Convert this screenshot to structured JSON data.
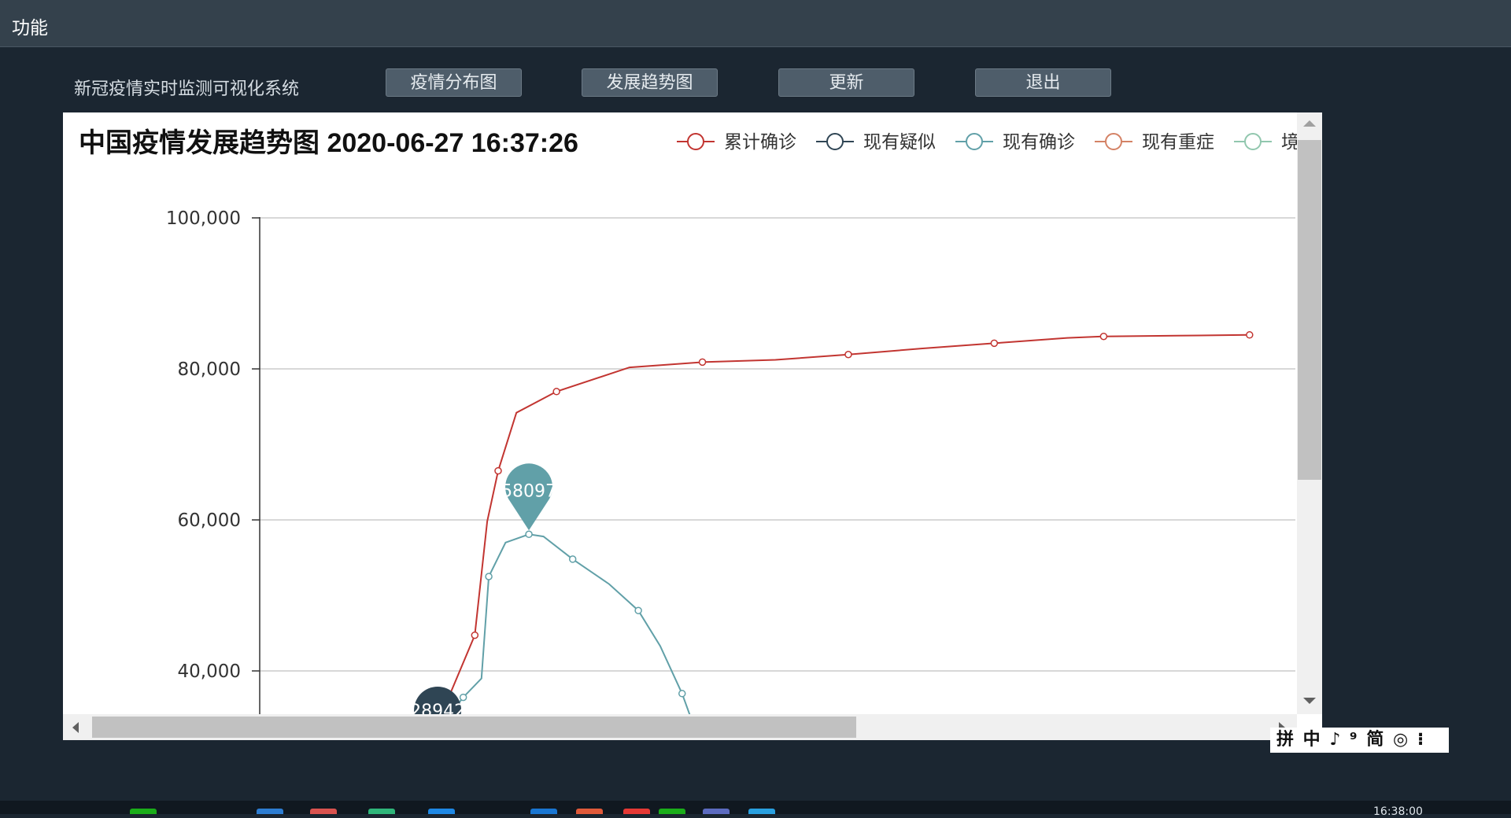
{
  "menubar": {
    "label": "功能"
  },
  "app": {
    "title": "新冠疫情实时监测可视化系统"
  },
  "nav": {
    "buttons": [
      {
        "label": "疫情分布图"
      },
      {
        "label": "发展趋势图"
      },
      {
        "label": "更新"
      },
      {
        "label": "退出"
      }
    ]
  },
  "chart_data": {
    "type": "line",
    "title": "中国疫情发展趋势图 2020-06-27 16:37:26",
    "legend_position": "top-right",
    "grid": true,
    "y_ticks": [
      "100,000",
      "80,000",
      "60,000",
      "40,000"
    ],
    "ylim_visible": [
      34000,
      100000
    ],
    "x_count": 20,
    "series": [
      {
        "name": "累计确诊",
        "color": "#c23531",
        "values": [
          36000,
          44730,
          59800,
          66500,
          74200,
          77000,
          80200,
          80900,
          81200,
          81900,
          82700,
          83400,
          84100,
          84300,
          84400,
          84500
        ]
      },
      {
        "name": "现有疑似",
        "color": "#2f4554",
        "values": [
          28942
        ],
        "markpoint": "28942"
      },
      {
        "name": "现有确诊",
        "color": "#61a0a8",
        "values": [
          34000,
          36500,
          39000,
          52500,
          57000,
          58097,
          57800,
          54800,
          51500,
          48000,
          43300,
          37000,
          33000
        ],
        "markpoint": "58097"
      },
      {
        "name": "现有重症",
        "color": "#d48265",
        "values": []
      },
      {
        "name": "境",
        "color": "#91c7ae",
        "values": []
      }
    ]
  },
  "ime": {
    "text": "拼 中 ♪ ⁹ 简 ◎ ⁝"
  },
  "taskbar": {
    "clock": "16:38:00",
    "icons": [
      {
        "color": "#1aad19"
      },
      {
        "color": "#2d7dd2"
      },
      {
        "color": "#d9534f"
      },
      {
        "color": "#2fb67a"
      },
      {
        "color": "#1e88e5"
      },
      {
        "color": "#1976d2"
      },
      {
        "color": "#e05a3a"
      },
      {
        "color": "#e53935"
      },
      {
        "color": "#1aad19"
      },
      {
        "color": "#5c6bc0"
      },
      {
        "color": "#29a0e0"
      }
    ]
  }
}
